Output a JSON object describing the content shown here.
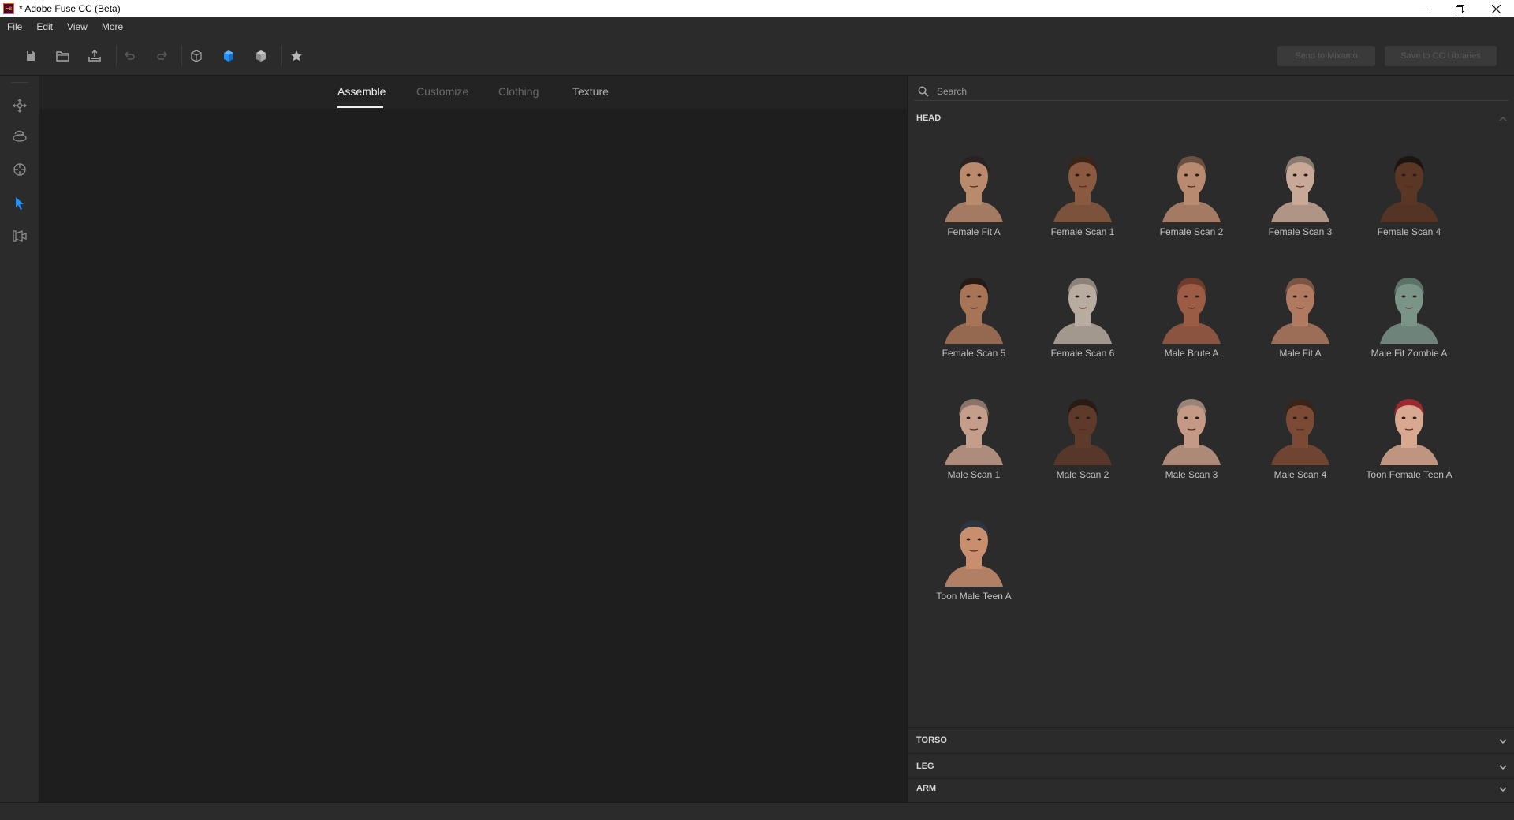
{
  "window": {
    "title": "* Adobe Fuse CC (Beta)",
    "app_icon_text": "Fs",
    "controls": [
      "minimize",
      "restore",
      "close"
    ]
  },
  "menu": [
    "File",
    "Edit",
    "View",
    "More"
  ],
  "toolbar": {
    "icons": [
      "new-icon",
      "open-icon",
      "import-icon",
      "undo-icon",
      "redo-icon",
      "cube-outline-icon",
      "cube-solid-icon",
      "cube-textured-icon",
      "star-icon"
    ],
    "send_label": "Send to Mixamo",
    "save_label": "Save to CC Libraries"
  },
  "left_rail": [
    "move-icon",
    "rotate-icon",
    "target-icon",
    "select-arrow-icon",
    "camera-icon"
  ],
  "tabs": [
    {
      "label": "Assemble",
      "active": true
    },
    {
      "label": "Customize",
      "active": false
    },
    {
      "label": "Clothing",
      "active": false
    },
    {
      "label": "Texture",
      "active": false
    }
  ],
  "search": {
    "placeholder": "Search"
  },
  "sections": {
    "head": "HEAD",
    "torso": "TORSO",
    "leg": "LEG",
    "arm": "ARM"
  },
  "heads": [
    {
      "label": "Female Fit A",
      "skin": "#b98a6c",
      "hair": "#2a2220"
    },
    {
      "label": "Female Scan 1",
      "skin": "#8a5a40",
      "hair": "#3a2418"
    },
    {
      "label": "Female Scan 2",
      "skin": "#b88a70",
      "hair": "#6a5040"
    },
    {
      "label": "Female Scan 3",
      "skin": "#c8a896",
      "hair": "#8a7a70"
    },
    {
      "label": "Female Scan 4",
      "skin": "#5a3624",
      "hair": "#1c1410"
    },
    {
      "label": "Female Scan 5",
      "skin": "#a87456",
      "hair": "#241a16"
    },
    {
      "label": "Female Scan 6",
      "skin": "#b8aca0",
      "hair": "#8c8278"
    },
    {
      "label": "Male Brute A",
      "skin": "#9c5c44",
      "hair": "#6e3c2c"
    },
    {
      "label": "Male Fit A",
      "skin": "#b07a60",
      "hair": "#7a5444"
    },
    {
      "label": "Male Fit Zombie A",
      "skin": "#7a9488",
      "hair": "#5a7268"
    },
    {
      "label": "Male Scan 1",
      "skin": "#c49e8a",
      "hair": "#8a7468"
    },
    {
      "label": "Male Scan 2",
      "skin": "#5e3a2a",
      "hair": "#2a1a14"
    },
    {
      "label": "Male Scan 3",
      "skin": "#c49a86",
      "hair": "#9a8478"
    },
    {
      "label": "Male Scan 4",
      "skin": "#7a4a34",
      "hair": "#3a2418"
    },
    {
      "label": "Toon Female Teen A",
      "skin": "#d8a890",
      "hair": "#9a2a30"
    },
    {
      "label": "Toon Male Teen A",
      "skin": "#c88e6e",
      "hair": "#2c3440"
    }
  ],
  "colors": {
    "accent": "#1e90ff",
    "panel": "#2b2b2b",
    "viewport": "#1e1e1e"
  }
}
